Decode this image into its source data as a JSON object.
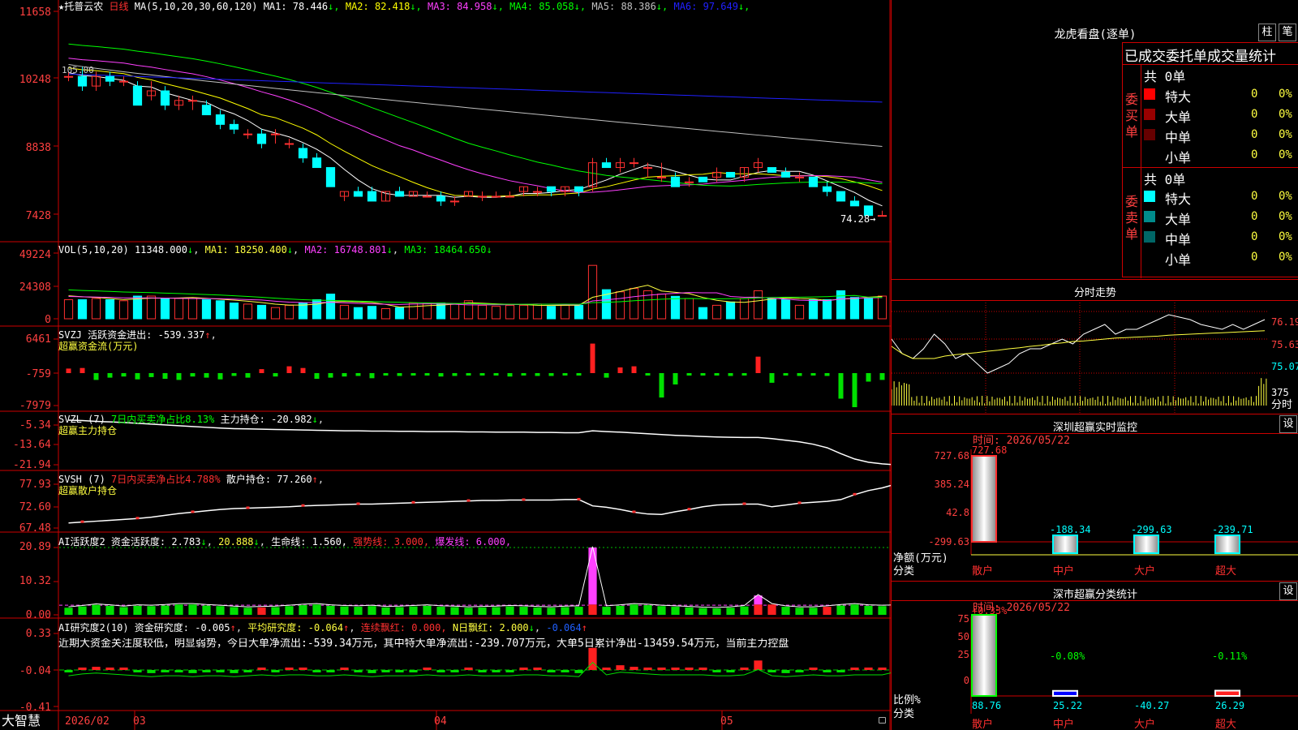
{
  "stock": {
    "star": "★",
    "name": "托普云农",
    "period": "日线",
    "ma_label": "MA(5,10,20,30,60,120)",
    "ma": [
      {
        "l": "MA1: 78.446",
        "c": "#ffffff"
      },
      {
        "l": "MA2: 82.418",
        "c": "#ffff00"
      },
      {
        "l": "MA3: 84.958",
        "c": "#ff40ff"
      },
      {
        "l": "MA4: 85.058",
        "c": "#00ff00"
      },
      {
        "l": "MA5: 88.386",
        "c": "#c0c0c0"
      },
      {
        "l": "MA6: 97.649",
        "c": "#2020ff"
      }
    ],
    "high_label": "105.00",
    "last_label": "74.28"
  },
  "axes": {
    "price": [
      "11658",
      "10248",
      "8838",
      "7428"
    ],
    "vol": [
      "49224",
      "24308",
      "0"
    ],
    "svzj": [
      "6461",
      "-759",
      "-7979"
    ],
    "svzl": [
      "-5.34",
      "-13.64",
      "-21.94"
    ],
    "svsh": [
      "77.93",
      "72.60",
      "67.48"
    ],
    "ai1": [
      "20.89",
      "10.32",
      "0.00"
    ],
    "ai2": [
      "0.33",
      "-0.04",
      "-0.41"
    ]
  },
  "vol": {
    "label": "VOL(5,10,20)",
    "v": "11348.000",
    "ma1": "MA1: 18250.400",
    "ma2": "MA2: 16748.801",
    "ma3": "MA3: 18464.650"
  },
  "svzj": {
    "label": "SVZJ  活跃资金进出:",
    "v": "-539.337",
    "sub": "超赢资金流(万元)"
  },
  "svzl": {
    "label": "SVZL (7)",
    "p": "7日内买卖净占比8.13%",
    "m": "主力持仓: -20.982",
    "sub": "超赢主力持仓"
  },
  "svsh": {
    "label": "SVSH (7)",
    "p": "7日内买卖净占比4.788%",
    "m": "散户持仓: 77.260",
    "sub": "超赢散户持仓"
  },
  "ai1": {
    "label": "AI活跃度2 资金活跃度: 2.783",
    "v2": "20.888",
    "v3": "生命线: 1.560,",
    "v4": "强势线: 3.000,",
    "v5": "爆发线: 6.000,"
  },
  "ai2": {
    "label": "AI研究度2(10) 资金研究度: -0.005",
    "v2": "平均研究度: -0.064",
    "v3": "连续飘红: 0.000,",
    "v4": "N日飘红: 2.000",
    "v5": "-0.064",
    "text": "近期大资金关注度较低，明显弱势，今日大单净流出:-539.34万元，其中特大单净流出:-239.707万元，大单5日累计净出-13459.54万元，当前主力控盘"
  },
  "xaxis": {
    "brand": "大智慧",
    "labels": [
      "2026/02",
      "03",
      "04",
      "05"
    ]
  },
  "right": {
    "title": "龙虎看盘(逐单)",
    "btn1": "柱",
    "btn2": "笔",
    "stat_title": "已成交委托单成交量统计",
    "buy_total": "共 0单",
    "sell_total": "共 0单",
    "buy_side": "委买单",
    "sell_side": "委卖单",
    "buy_rows": [
      {
        "n": "特大",
        "v": "0",
        "p": "0%",
        "c": "#ff0000"
      },
      {
        "n": "大单",
        "v": "0",
        "p": "0%",
        "c": "#990000"
      },
      {
        "n": "中单",
        "v": "0",
        "p": "0%",
        "c": "#660000"
      },
      {
        "n": "小单",
        "v": "0",
        "p": "0%",
        "c": ""
      }
    ],
    "sell_rows": [
      {
        "n": "特大",
        "v": "0",
        "p": "0%",
        "c": "#00ffff"
      },
      {
        "n": "大单",
        "v": "0",
        "p": "0%",
        "c": "#008b8b"
      },
      {
        "n": "中单",
        "v": "0",
        "p": "0%",
        "c": "#006666"
      },
      {
        "n": "小单",
        "v": "0",
        "p": "0%",
        "c": ""
      }
    ],
    "intraday": {
      "title": "分时走势",
      "prices": [
        "76.19",
        "75.63",
        "75.07"
      ],
      "vol": "375",
      "vol_unit": "分时"
    },
    "monitor": {
      "title": "深圳超赢实时监控",
      "btn": "设",
      "time": "时间: 2026/05/22",
      "axis": [
        "727.68",
        "385.24",
        "42.8",
        "-299.63"
      ],
      "ylabel": "净额(万元)",
      "xlabel": "分类",
      "cats": [
        "散户",
        "中户",
        "大户",
        "超大"
      ],
      "values": [
        727.68,
        -188.34,
        -299.63,
        -239.71
      ],
      "labels": [
        "727.68",
        "-188.34",
        "-299.63",
        "-239.71"
      ]
    },
    "classify": {
      "title": "深市超赢分类统计",
      "btn": "设",
      "time": "时间: 2026/05/22",
      "axis": [
        "75",
        "50",
        "25",
        "0"
      ],
      "ylabel": "比例%",
      "xlabel": "分类",
      "cats": [
        "散户",
        "中户",
        "大户",
        "超大"
      ],
      "top": [
        "+0.33%",
        "-0.08%",
        "",
        "-0.11%"
      ],
      "bottom": [
        "88.76",
        "25.22",
        "-40.27",
        "26.29"
      ]
    }
  },
  "chart_data": {
    "type": "candlestick",
    "title": "托普云农 日线",
    "y_range": [
      74.28,
      116.58
    ],
    "ohlc": [
      [
        103,
        104,
        102,
        103
      ],
      [
        103,
        105,
        100,
        101
      ],
      [
        101,
        104,
        100,
        103
      ],
      [
        103,
        104,
        101,
        102
      ],
      [
        102,
        103,
        101,
        102
      ],
      [
        101,
        102,
        97,
        97
      ],
      [
        99,
        102,
        98,
        100
      ],
      [
        100,
        101,
        96,
        97
      ],
      [
        97,
        99,
        96,
        98
      ],
      [
        98,
        99,
        96,
        98
      ],
      [
        97,
        98,
        95,
        95
      ],
      [
        95,
        96,
        92,
        93
      ],
      [
        93,
        94,
        91,
        92
      ],
      [
        91,
        92,
        90,
        91
      ],
      [
        91,
        92,
        88,
        89
      ],
      [
        91,
        92,
        89,
        91
      ],
      [
        89,
        90,
        88,
        89
      ],
      [
        88,
        89,
        85,
        86
      ],
      [
        86,
        87,
        84,
        84
      ],
      [
        84,
        84,
        80,
        80
      ],
      [
        78,
        79,
        77,
        79
      ],
      [
        79,
        80,
        78,
        78
      ],
      [
        79,
        80,
        77,
        77
      ],
      [
        77,
        79,
        77,
        79
      ],
      [
        79,
        80,
        78,
        78
      ],
      [
        78,
        79,
        78,
        79
      ],
      [
        78,
        79,
        78,
        78
      ],
      [
        78,
        79,
        76,
        77
      ],
      [
        77,
        78,
        76,
        77
      ],
      [
        78,
        79,
        78,
        79
      ],
      [
        78,
        79,
        77,
        78
      ],
      [
        78,
        79,
        78,
        78
      ],
      [
        78,
        79,
        78,
        78
      ],
      [
        79,
        80,
        78,
        80
      ],
      [
        79,
        80,
        78,
        79
      ],
      [
        80,
        80,
        78,
        79
      ],
      [
        79,
        80,
        78,
        80
      ],
      [
        80,
        80,
        78,
        79
      ],
      [
        80,
        86,
        79,
        85
      ],
      [
        85,
        86,
        84,
        84
      ],
      [
        84,
        86,
        83,
        85
      ],
      [
        85,
        86,
        84,
        85
      ],
      [
        84,
        85,
        82,
        84
      ],
      [
        82,
        85,
        81,
        82
      ],
      [
        82,
        83,
        80,
        80
      ],
      [
        81,
        82,
        80,
        81
      ],
      [
        82,
        82,
        81,
        81
      ],
      [
        82,
        84,
        81,
        83
      ],
      [
        83,
        83,
        82,
        82
      ],
      [
        82,
        84,
        81,
        84
      ],
      [
        84,
        86,
        83,
        85
      ],
      [
        84,
        84,
        83,
        83
      ],
      [
        83,
        84,
        82,
        82
      ],
      [
        82,
        83,
        81,
        82
      ],
      [
        82,
        82,
        80,
        80
      ],
      [
        80,
        81,
        78,
        79
      ],
      [
        79,
        79,
        77,
        77
      ],
      [
        77,
        78,
        76,
        76
      ],
      [
        76,
        76,
        74,
        74
      ],
      [
        74,
        75,
        74,
        74
      ]
    ],
    "volume": [
      14300,
      14300,
      15200,
      14300,
      13500,
      17000,
      17000,
      15200,
      15200,
      15200,
      14300,
      13500,
      11800,
      11000,
      10100,
      8400,
      10100,
      11800,
      14300,
      18500,
      10100,
      8400,
      9300,
      7600,
      8400,
      11800,
      11800,
      11800,
      11000,
      13500,
      10100,
      9300,
      10100,
      10100,
      11000,
      9300,
      10100,
      10100,
      40000,
      21800,
      20200,
      22700,
      21000,
      18500,
      16800,
      15200,
      8400,
      10100,
      12600,
      15200,
      21000,
      15200,
      14300,
      10100,
      14300,
      14300,
      21000,
      16000,
      15200,
      17000,
      9000
    ],
    "vol_ma": {
      "MA1": 18250.4,
      "MA2": 16748.801,
      "MA3": 18464.65
    },
    "svzj": [
      80,
      90,
      -120,
      -80,
      -60,
      -110,
      -70,
      -100,
      -120,
      -60,
      -80,
      -110,
      -50,
      -80,
      70,
      -60,
      120,
      90,
      -100,
      -80,
      -60,
      -50,
      -90,
      -40,
      -50,
      -30,
      -40,
      -60,
      -50,
      -40,
      -30,
      -40,
      -60,
      -30,
      -50,
      -50,
      -40,
      -30,
      520,
      -80,
      100,
      120,
      -40,
      -430,
      -200,
      -40,
      -40,
      -40,
      -50,
      -40,
      290,
      -170,
      -40,
      -50,
      -30,
      -50,
      -450,
      -600,
      -150,
      -120,
      -80
    ],
    "svzl": [
      -5.34,
      -5.5,
      -5.8,
      -6.0,
      -6.2,
      -6.5,
      -6.8,
      -7.1,
      -7.4,
      -7.7,
      -8.0,
      -8.3,
      -8.5,
      -8.6,
      -8.7,
      -8.8,
      -8.9,
      -9.0,
      -9.1,
      -9.2,
      -9.3,
      -9.3,
      -9.4,
      -9.4,
      -9.5,
      -9.5,
      -9.6,
      -9.6,
      -9.6,
      -9.7,
      -9.7,
      -9.8,
      -9.8,
      -9.8,
      -9.9,
      -9.9,
      -10.0,
      -10.0,
      -9.3,
      -9.6,
      -9.8,
      -10.1,
      -10.4,
      -10.7,
      -11.0,
      -11.2,
      -11.4,
      -11.6,
      -11.7,
      -11.8,
      -11.8,
      -12.2,
      -12.8,
      -13.4,
      -14.3,
      -15.6,
      -17.8,
      -19.8,
      -21.0,
      -21.6,
      -21.94
    ],
    "svsh": [
      68.6,
      68.8,
      69.0,
      69.2,
      69.4,
      69.6,
      69.9,
      70.3,
      70.7,
      71.0,
      71.3,
      71.6,
      71.8,
      71.9,
      72.0,
      72.1,
      72.2,
      72.4,
      72.5,
      72.6,
      72.7,
      72.8,
      72.8,
      72.9,
      73.0,
      73.1,
      73.2,
      73.3,
      73.4,
      73.5,
      73.6,
      73.6,
      73.7,
      73.7,
      73.7,
      73.7,
      73.8,
      73.8,
      72.4,
      72.1,
      71.6,
      71.0,
      70.6,
      70.5,
      71.1,
      71.6,
      72.2,
      72.6,
      72.7,
      72.8,
      72.8,
      72.2,
      72.6,
      73.0,
      73.2,
      73.4,
      73.8,
      74.9,
      75.8,
      76.4,
      77.26
    ],
    "ai1": [
      2.2,
      2.6,
      3.1,
      2.8,
      2.4,
      2.8,
      2.7,
      2.9,
      3.2,
      3.2,
      2.9,
      2.7,
      2.4,
      2.2,
      2.3,
      2.4,
      2.7,
      3.0,
      3.2,
      2.8,
      2.6,
      2.5,
      2.7,
      2.3,
      2.4,
      2.6,
      2.8,
      2.5,
      2.4,
      2.2,
      2.3,
      2.4,
      2.6,
      2.5,
      2.3,
      2.2,
      2.4,
      2.5,
      20.888,
      2.5,
      2.8,
      3.2,
      3.0,
      2.7,
      2.5,
      2.3,
      2.1,
      2.0,
      2.2,
      2.6,
      6.0,
      3.2,
      2.5,
      2.2,
      2.2,
      2.5,
      2.9,
      3.2,
      2.8,
      2.7,
      2.783
    ],
    "ai1_red": [
      14,
      38,
      50,
      51,
      55
    ],
    "ai2": [
      -0.05,
      -0.03,
      -0.02,
      -0.03,
      -0.04,
      -0.05,
      -0.06,
      -0.05,
      -0.05,
      -0.06,
      -0.05,
      -0.05,
      -0.06,
      -0.05,
      -0.04,
      -0.05,
      -0.04,
      -0.04,
      -0.05,
      -0.05,
      -0.04,
      -0.05,
      -0.06,
      -0.05,
      -0.05,
      -0.05,
      -0.04,
      -0.05,
      -0.05,
      -0.04,
      -0.05,
      -0.05,
      -0.05,
      -0.04,
      -0.04,
      -0.05,
      -0.05,
      -0.06,
      0.1,
      -0.04,
      -0.01,
      -0.02,
      -0.03,
      -0.04,
      -0.04,
      -0.04,
      -0.04,
      -0.05,
      -0.05,
      -0.04,
      0.02,
      -0.05,
      -0.06,
      -0.05,
      -0.04,
      -0.05,
      -0.05,
      -0.04,
      -0.04,
      -0.04,
      -0.005
    ],
    "intraday": [
      75.6,
      75.3,
      75.2,
      75.4,
      75.7,
      75.5,
      75.2,
      75.3,
      75.1,
      74.9,
      75.0,
      75.1,
      75.3,
      75.4,
      75.4,
      75.5,
      75.6,
      75.5,
      75.7,
      75.8,
      75.9,
      75.7,
      75.8,
      75.8,
      75.9,
      76.0,
      76.1,
      76.05,
      76.0,
      75.9,
      75.85,
      75.8,
      75.9,
      75.8,
      75.9,
      76.0
    ],
    "intraday_avg": [
      75.45,
      75.3,
      75.2,
      75.2,
      75.2,
      75.25,
      75.28,
      75.3,
      75.32,
      75.35,
      75.37,
      75.4,
      75.42,
      75.45,
      75.47,
      75.5,
      75.52,
      75.55,
      75.56,
      75.58,
      75.6,
      75.62,
      75.63,
      75.64,
      75.65,
      75.66,
      75.68,
      75.69,
      75.7,
      75.71,
      75.72,
      75.73,
      75.74,
      75.75,
      75.76,
      75.77
    ]
  }
}
